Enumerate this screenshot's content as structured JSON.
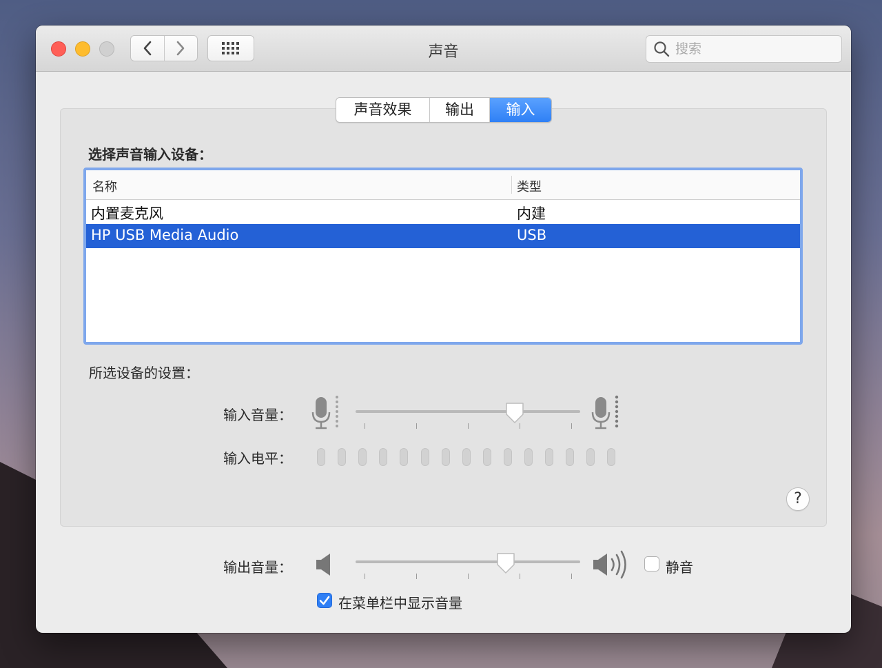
{
  "window": {
    "title": "声音",
    "search_placeholder": "搜索"
  },
  "icons": {
    "close": "close-traffic-light",
    "minimize": "minimize-traffic-light",
    "zoom": "zoom-traffic-light",
    "back": "chevron-left-icon",
    "forward": "chevron-right-icon",
    "show_all": "grid-icon",
    "search": "search-icon"
  },
  "tabs": [
    {
      "label": "声音效果",
      "active": false
    },
    {
      "label": "输出",
      "active": false
    },
    {
      "label": "输入",
      "active": true
    }
  ],
  "input": {
    "device_section_label": "选择声音输入设备：",
    "table": {
      "columns": [
        "名称",
        "类型"
      ],
      "rows": [
        {
          "name": "内置麦克风",
          "type": "内建",
          "selected": false
        },
        {
          "name": "HP USB Media Audio",
          "type": "USB",
          "selected": true
        }
      ]
    },
    "settings_label": "所选设备的设置：",
    "volume_label": "输入音量：",
    "volume_level": 0.71,
    "level_label": "输入电平：",
    "level_bars_total": 15,
    "level_bars_lit": 0
  },
  "output": {
    "volume_label": "输出音量：",
    "volume_level": 0.67,
    "mute_label": "静音",
    "mute_checked": false,
    "show_in_menubar_label": "在菜单栏中显示音量",
    "show_in_menubar_checked": true
  },
  "help_label": "?",
  "colors": {
    "accent": "#2f80f5",
    "selection": "#2461d6",
    "focus_ring": "#7ea7ec"
  }
}
